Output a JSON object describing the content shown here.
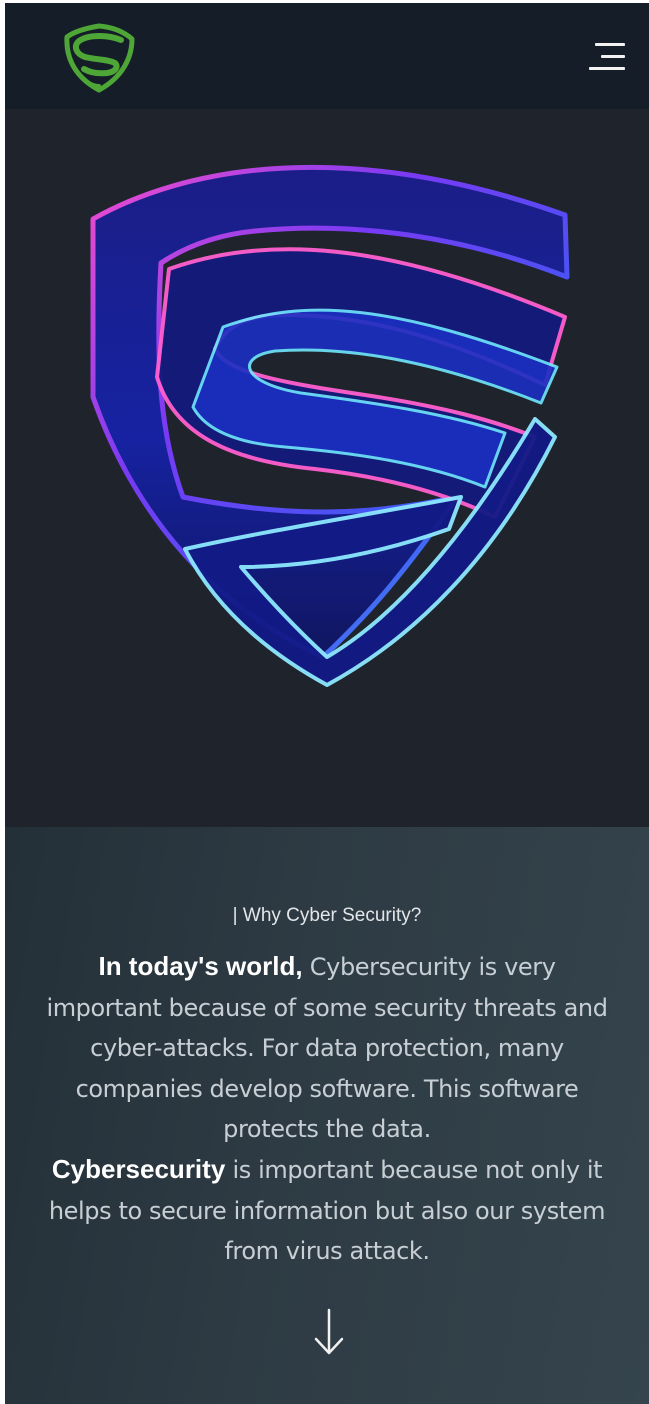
{
  "header": {
    "logo_icon": "shield-s-logo-icon",
    "menu_icon": "hamburger-menu-icon"
  },
  "hero": {
    "image_icon": "neon-shield-s-illustration"
  },
  "why": {
    "kicker": "| Why Cyber Security?",
    "paragraph1_lead": "In today's world,",
    "paragraph1_text": " Cybersecurity is very important because of some security threats and cyber-attacks. For data protection, many companies develop software. This software protects the data.",
    "paragraph2_lead": "Cybersecurity",
    "paragraph2_text": " is important because not only it helps to secure information but also our system from virus attack.",
    "scroll_icon": "arrow-down-icon"
  },
  "colors": {
    "header_bg": "#151d29",
    "hero_bg": "#1f232b",
    "logo_green": "#4ea636",
    "text_light": "#c7ced4",
    "text_bold": "#ffffff"
  }
}
